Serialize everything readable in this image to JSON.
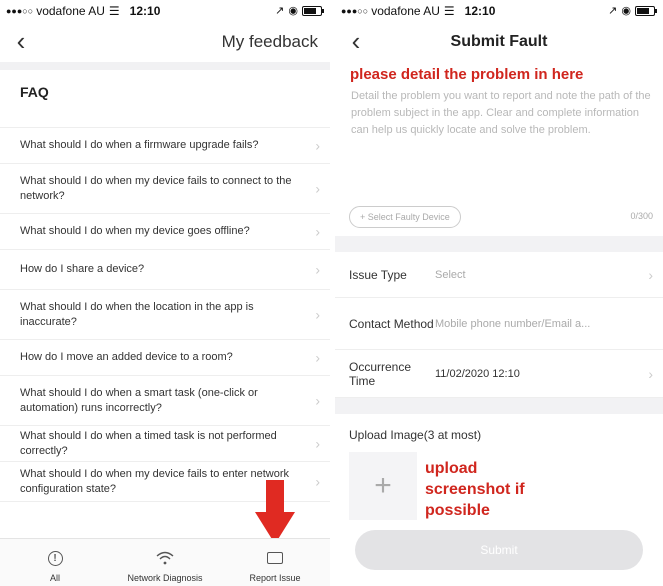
{
  "left": {
    "status": {
      "carrier": "vodafone AU",
      "time": "12:10"
    },
    "nav": {
      "title": "My feedback",
      "back_icon": "chevron-left"
    },
    "faq": {
      "title": "FAQ",
      "items": [
        "What should I do when a firmware upgrade fails?",
        "What should I do when my device fails to connect to the network?",
        "What should I do when my device goes offline?",
        "How do I share a device?",
        "What should I do when the location in the app is inaccurate?",
        "How do I move an added device to a room?",
        "What should I do when a smart task (one-click or automation) runs incorrectly?",
        "What should I do when a timed task is not performed correctly?",
        "What should I do when my device fails to enter network configuration state?"
      ]
    },
    "tabbar": {
      "tabs": [
        {
          "label": "All",
          "icon": "info-circle-icon"
        },
        {
          "label": "Network Diagnosis",
          "icon": "wifi-icon"
        },
        {
          "label": "Report Issue",
          "icon": "chat-bubble-icon"
        }
      ]
    },
    "annotation_color": "#d0261e"
  },
  "right": {
    "status": {
      "carrier": "vodafone AU",
      "time": "12:10"
    },
    "nav": {
      "title": "Submit Fault"
    },
    "hint": "please detail the problem in here",
    "description_placeholder": "Detail the problem you want to report and note the path of the problem subject in the app. Clear and complete information can help us quickly locate and solve the problem.",
    "select_device": "+ Select Faulty Device",
    "counter": "0/300",
    "issue_type": {
      "label": "Issue Type",
      "value": "Select"
    },
    "contact_method": {
      "label": "Contact Method",
      "placeholder": "Mobile phone number/Email a..."
    },
    "occurrence_time": {
      "label": "Occurrence Time",
      "value": "11/02/2020 12:10"
    },
    "upload": {
      "label": "Upload Image(3 at most)",
      "note": "upload screenshot if possible"
    },
    "submit": "Submit"
  }
}
